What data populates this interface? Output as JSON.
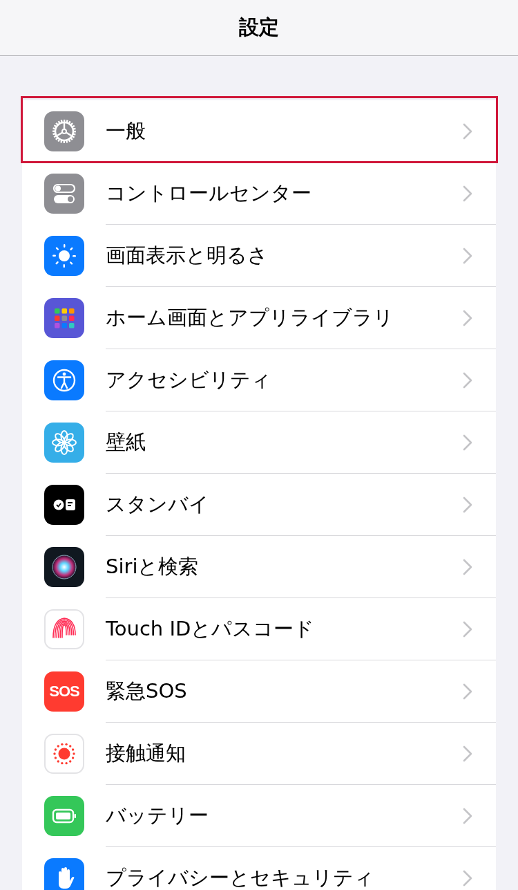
{
  "nav_bar": {
    "title": "設定"
  },
  "settings": [
    {
      "label": "一般",
      "kind": "gear",
      "highlighted": true
    },
    {
      "label": "コントロールセンター",
      "kind": "toggles",
      "highlighted": false
    },
    {
      "label": "画面表示と明るさ",
      "kind": "sun",
      "highlighted": false
    },
    {
      "label": "ホーム画面とアプリライブラリ",
      "kind": "grid",
      "highlighted": false
    },
    {
      "label": "アクセシビリティ",
      "kind": "accessibility",
      "highlighted": false
    },
    {
      "label": "壁紙",
      "kind": "flower",
      "highlighted": false
    },
    {
      "label": "スタンバイ",
      "kind": "standby",
      "highlighted": false
    },
    {
      "label": "Siriと検索",
      "kind": "orb",
      "highlighted": false
    },
    {
      "label": "Touch IDとパスコード",
      "kind": "fingerprint",
      "highlighted": false
    },
    {
      "label": "緊急SOS",
      "kind": "sos",
      "icon_text": "SOS",
      "highlighted": false
    },
    {
      "label": "接触通知",
      "kind": "exposure",
      "highlighted": false
    },
    {
      "label": "バッテリー",
      "kind": "battery",
      "highlighted": false
    },
    {
      "label": "プライバシーとセキュリティ",
      "kind": "hand",
      "highlighted": false
    }
  ]
}
